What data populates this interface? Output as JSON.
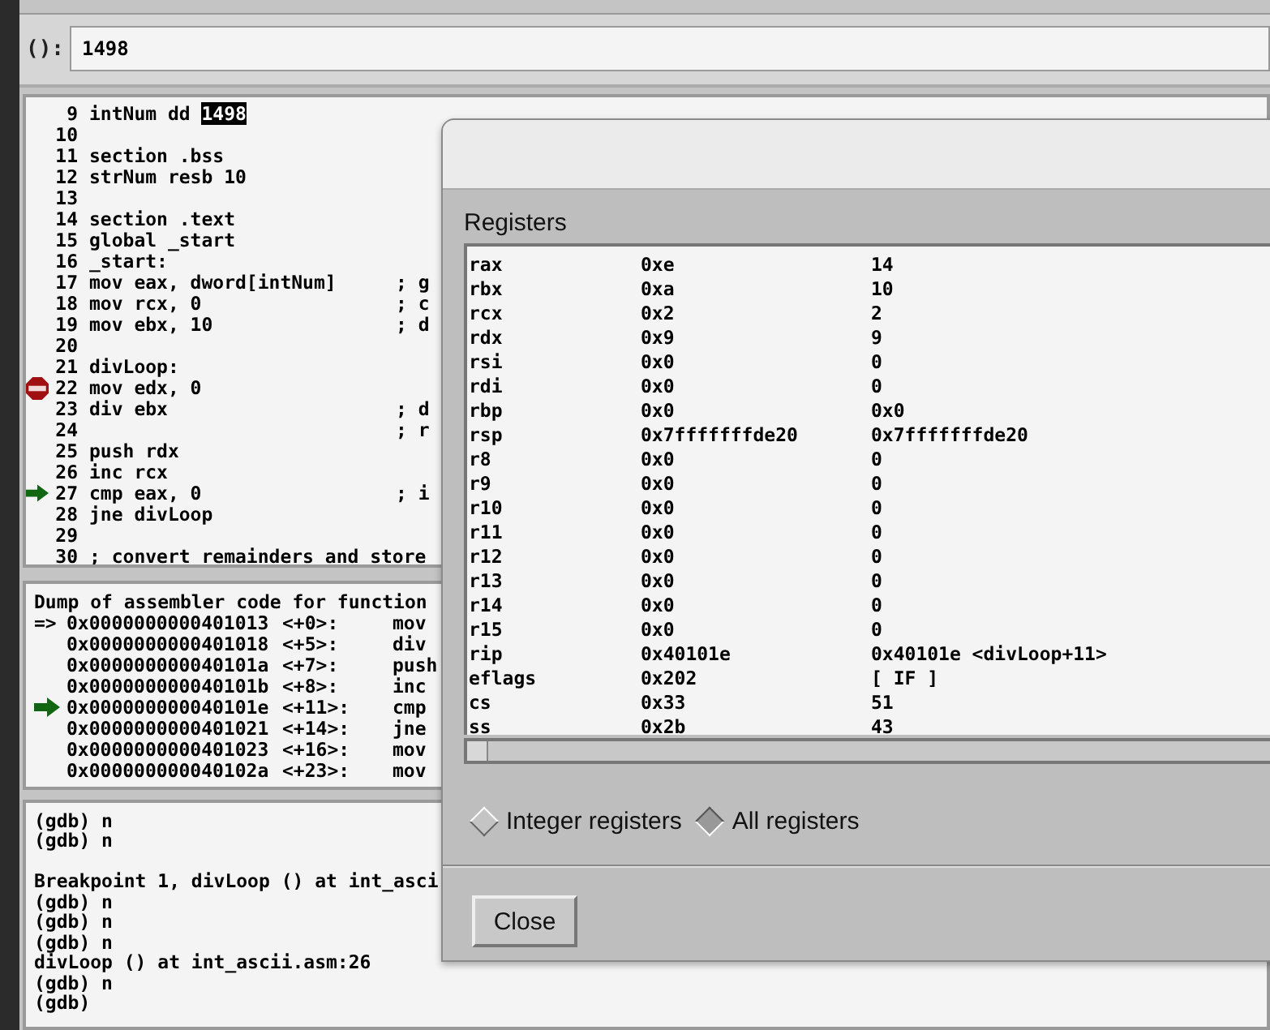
{
  "argument_field": {
    "label": "():",
    "value": "1498"
  },
  "source": [
    {
      "num": "9",
      "code": "intNum dd ",
      "selection": "1498",
      "breakpoint": false,
      "current": false
    },
    {
      "num": "10",
      "breakpoint": false,
      "current": false
    },
    {
      "num": "11",
      "code": "section .bss",
      "breakpoint": false,
      "current": false
    },
    {
      "num": "12",
      "code": "strNum resb 10",
      "breakpoint": false,
      "current": false
    },
    {
      "num": "13",
      "breakpoint": false,
      "current": false
    },
    {
      "num": "14",
      "code": "section .text",
      "breakpoint": false,
      "current": false
    },
    {
      "num": "15",
      "code": "global _start",
      "breakpoint": false,
      "current": false
    },
    {
      "num": "16",
      "code": "_start:",
      "breakpoint": false,
      "current": false
    },
    {
      "num": "17",
      "code": "mov eax, dword[intNum]",
      "comment": "; g",
      "breakpoint": false,
      "current": false
    },
    {
      "num": "18",
      "code": "mov rcx, 0",
      "comment": "; c",
      "breakpoint": false,
      "current": false
    },
    {
      "num": "19",
      "code": "mov ebx, 10",
      "comment": "; d",
      "breakpoint": false,
      "current": false
    },
    {
      "num": "20",
      "breakpoint": false,
      "current": false
    },
    {
      "num": "21",
      "code": "divLoop:",
      "breakpoint": false,
      "current": false
    },
    {
      "num": "22",
      "code": "mov edx, 0",
      "breakpoint": true,
      "current": false
    },
    {
      "num": "23",
      "code": "div ebx",
      "comment": "; d",
      "breakpoint": false,
      "current": false
    },
    {
      "num": "24",
      "comment": "; r",
      "breakpoint": false,
      "current": false
    },
    {
      "num": "25",
      "code": "push rdx",
      "breakpoint": false,
      "current": false
    },
    {
      "num": "26",
      "code": "inc rcx",
      "breakpoint": false,
      "current": false
    },
    {
      "num": "27",
      "code": "cmp eax, 0",
      "comment": "; i",
      "breakpoint": false,
      "current": true
    },
    {
      "num": "28",
      "code": "jne divLoop",
      "breakpoint": false,
      "current": false
    },
    {
      "num": "29",
      "breakpoint": false,
      "current": false
    },
    {
      "num": "30",
      "code": "; convert remainders and store",
      "breakpoint": false,
      "current": false
    }
  ],
  "disassembly": {
    "header": "Dump of assembler code for function",
    "lines": [
      {
        "prefix": "=>",
        "address": "0x0000000000401013",
        "offset": "<+0>:",
        "instr": "mov",
        "current": false
      },
      {
        "address": "0x0000000000401018",
        "offset": "<+5>:",
        "instr": "div",
        "current": false
      },
      {
        "address": "0x000000000040101a",
        "offset": "<+7>:",
        "instr": "push",
        "current": false
      },
      {
        "address": "0x000000000040101b",
        "offset": "<+8>:",
        "instr": "inc",
        "current": false
      },
      {
        "address": "0x000000000040101e",
        "offset": "<+11>:",
        "instr": "cmp",
        "current": true
      },
      {
        "address": "0x0000000000401021",
        "offset": "<+14>:",
        "instr": "jne",
        "current": false
      },
      {
        "address": "0x0000000000401023",
        "offset": "<+16>:",
        "instr": "mov",
        "current": false
      },
      {
        "address": "0x000000000040102a",
        "offset": "<+23>:",
        "instr": "mov",
        "current": false
      }
    ]
  },
  "console": [
    {
      "text": "(gdb) n"
    },
    {
      "text": "(gdb) n"
    },
    {
      "text": "Breakpoint 1, divLoop () at int_asci",
      "gap_before": true
    },
    {
      "text": "(gdb) n"
    },
    {
      "text": "(gdb) n"
    },
    {
      "text": "(gdb) n"
    },
    {
      "text": "divLoop () at int_ascii.asm:26"
    },
    {
      "text": "(gdb) n"
    },
    {
      "text": "(gdb)"
    }
  ],
  "registers_dialog": {
    "title": "Registers",
    "rows": [
      [
        "rax",
        "0xe",
        "14"
      ],
      [
        "rbx",
        "0xa",
        "10"
      ],
      [
        "rcx",
        "0x2",
        "2"
      ],
      [
        "rdx",
        "0x9",
        "9"
      ],
      [
        "rsi",
        "0x0",
        "0"
      ],
      [
        "rdi",
        "0x0",
        "0"
      ],
      [
        "rbp",
        "0x0",
        "0x0"
      ],
      [
        "rsp",
        "0x7fffffffde20",
        "0x7fffffffde20"
      ],
      [
        "r8",
        "0x0",
        "0"
      ],
      [
        "r9",
        "0x0",
        "0"
      ],
      [
        "r10",
        "0x0",
        "0"
      ],
      [
        "r11",
        "0x0",
        "0"
      ],
      [
        "r12",
        "0x0",
        "0"
      ],
      [
        "r13",
        "0x0",
        "0"
      ],
      [
        "r14",
        "0x0",
        "0"
      ],
      [
        "r15",
        "0x0",
        "0"
      ],
      [
        "rip",
        "0x40101e",
        "0x40101e <divLoop+11>"
      ],
      [
        "eflags",
        "0x202",
        "[ IF ]"
      ],
      [
        "cs",
        "0x33",
        "51"
      ],
      [
        "ss",
        "0x2b",
        "43"
      ]
    ],
    "options": [
      {
        "label": "Integer registers",
        "selected": false
      },
      {
        "label": "All registers",
        "selected": true
      }
    ],
    "close_button": "Close"
  }
}
